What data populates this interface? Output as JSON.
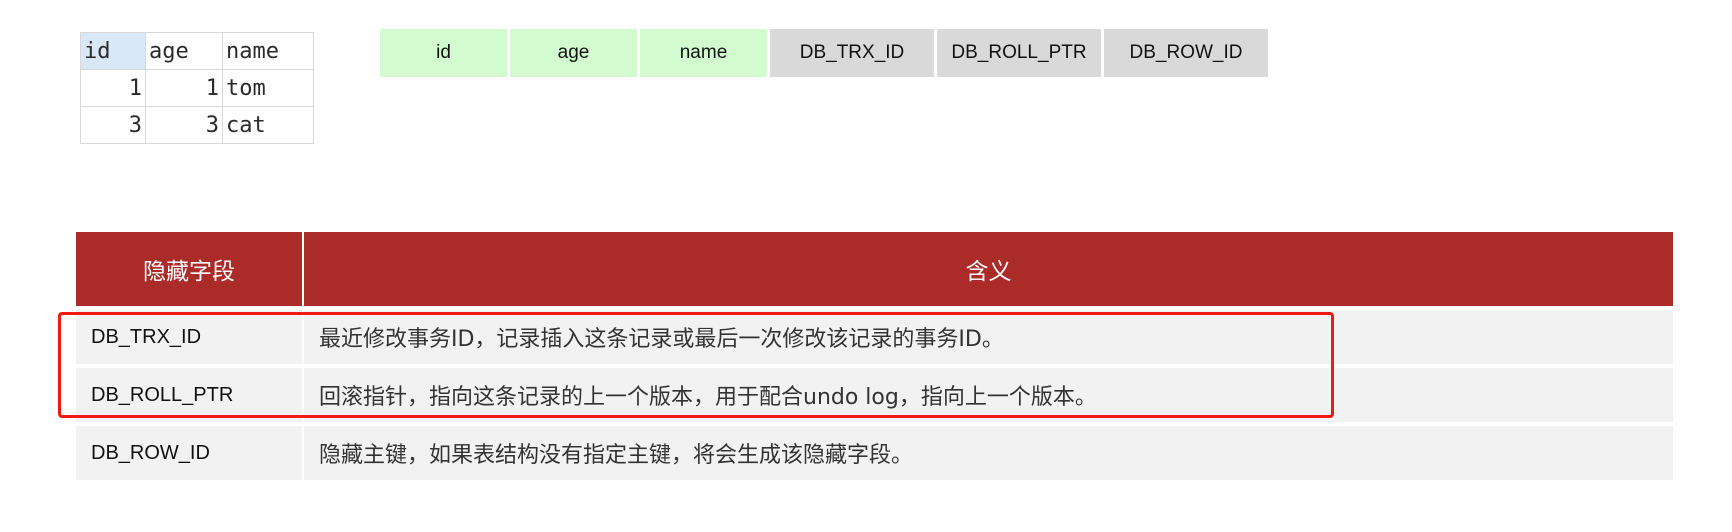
{
  "result_table": {
    "columns": [
      "id",
      "age",
      "name"
    ],
    "rows": [
      [
        "1",
        "1",
        "tom"
      ],
      [
        "3",
        "3",
        "cat"
      ]
    ]
  },
  "row_structure": {
    "user_fields": [
      "id",
      "age",
      "name"
    ],
    "hidden_fields": [
      "DB_TRX_ID",
      "DB_ROLL_PTR",
      "DB_ROW_ID"
    ],
    "colors": {
      "user_field": "#d3fbd0",
      "hidden_field": "#d9d9d9"
    }
  },
  "hidden_fields_table": {
    "headers": [
      "隐藏字段",
      "含义"
    ],
    "rows": [
      {
        "field": "DB_TRX_ID",
        "meaning": "最近修改事务ID，记录插入这条记录或最后一次修改该记录的事务ID。"
      },
      {
        "field": "DB_ROLL_PTR",
        "meaning": "回滚指针，指向这条记录的上一个版本，用于配合undo log，指向上一个版本。"
      },
      {
        "field": "DB_ROW_ID",
        "meaning": "隐藏主键，如果表结构没有指定主键，将会生成该隐藏字段。"
      }
    ],
    "colors": {
      "header": "#ab2b28",
      "row": "#f2f2f2",
      "highlight": "#f01a12"
    },
    "highlighted_rows": [
      "DB_TRX_ID",
      "DB_ROLL_PTR"
    ]
  }
}
